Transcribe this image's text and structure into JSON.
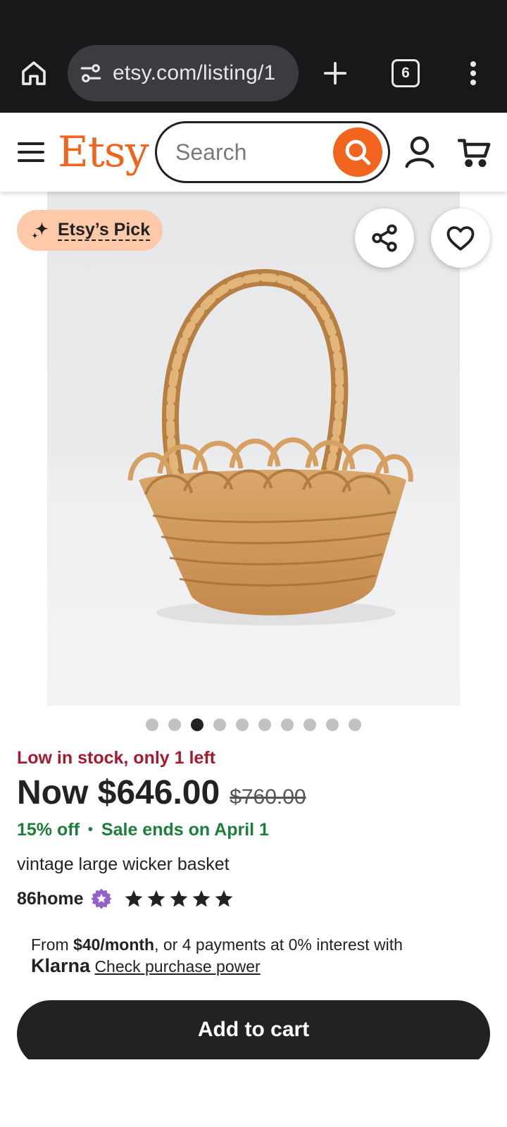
{
  "browser": {
    "url": "etsy.com/listing/1",
    "tab_count": "6",
    "icons": [
      "home-icon",
      "site-settings-icon",
      "new-tab-icon",
      "tab-switcher-icon",
      "overflow-menu-icon"
    ]
  },
  "header": {
    "logo": "Etsy",
    "search_placeholder": "Search",
    "brand_color": "#f1641e"
  },
  "gallery": {
    "badge_label": "Etsy’s Pick",
    "badge_color": "#fdc9a8",
    "image_count": 10,
    "active_index": 2
  },
  "product": {
    "stock_notice": "Low in stock, only 1 left",
    "price_now": "Now $646.00",
    "price_was": "$760.00",
    "discount": "15% off",
    "sale_ends": "Sale ends on April 1",
    "title": "vintage large wicker basket",
    "shop_name": "86home",
    "rating": 5,
    "stock_color": "#a61a2e",
    "sale_color": "#1b7f3a"
  },
  "klarna": {
    "prefix": "From ",
    "amount": "$40/month",
    "suffix": ", or 4 payments at 0% interest with",
    "brand": "Klarna",
    "link": "Check purchase power"
  },
  "actions": {
    "add_to_cart": "Add to cart"
  }
}
